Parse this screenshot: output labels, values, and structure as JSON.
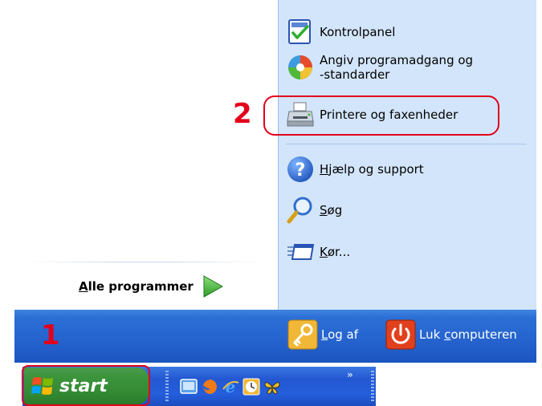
{
  "start_menu": {
    "all_programs": {
      "label_underlined": "A",
      "label_rest": "lle programmer"
    },
    "right_items": [
      {
        "id": "kontrolpanel",
        "label": "Kontrolpanel",
        "icon": "control-panel-icon"
      },
      {
        "id": "programadgang",
        "line1": "Angiv programadgang og",
        "line2": "-standarder",
        "icon": "program-access-icon"
      },
      {
        "id": "printere",
        "label": "Printere og faxenheder",
        "icon": "printer-icon"
      },
      {
        "id": "hjaelp",
        "label_underlined": "H",
        "label_rest": "jælp og support",
        "icon": "help-icon"
      },
      {
        "id": "soeg",
        "label_underlined": "S",
        "label_rest": "øg",
        "icon": "search-icon"
      },
      {
        "id": "koer",
        "label_underlined": "K",
        "label_rest": "ør...",
        "icon": "run-icon"
      }
    ],
    "bottom": {
      "log_off": {
        "label_underlined": "L",
        "label_rest": "og af",
        "icon": "key-icon"
      },
      "shut_down": {
        "label_pre": "Luk ",
        "label_underlined": "c",
        "label_rest": "omputeren",
        "icon": "power-icon"
      }
    }
  },
  "taskbar": {
    "start_label": "start",
    "quick_launch": [
      "show-desktop-icon",
      "firefox-icon",
      "internet-explorer-icon",
      "clock-icon",
      "butterfly-icon"
    ],
    "overflow_chevron": "»"
  },
  "annotations": {
    "step1": "1",
    "step2": "2"
  },
  "colors": {
    "right_pane": "#d3e5fa",
    "bar_blue": "#2562cd",
    "start_green": "#3c943c",
    "callout_red": "#e3001b"
  }
}
